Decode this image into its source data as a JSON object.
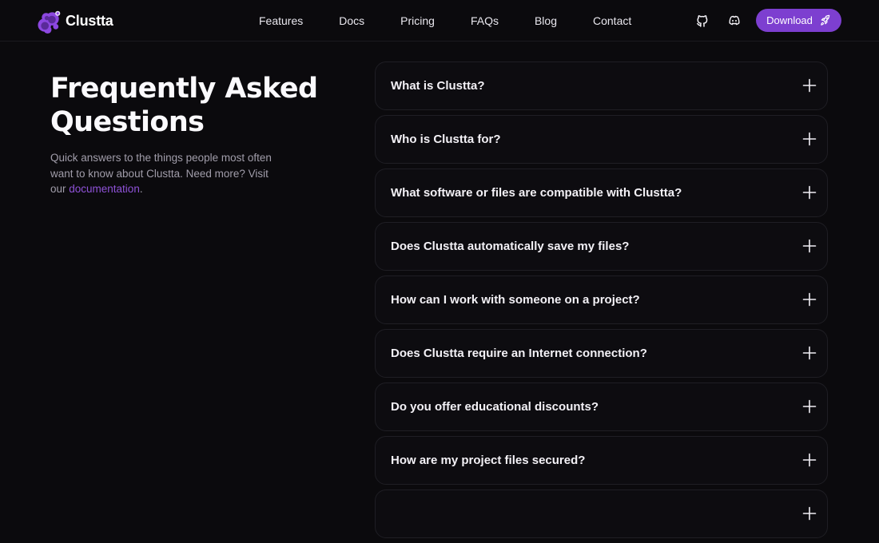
{
  "nav": {
    "brand": "Clustta",
    "links": [
      "Features",
      "Docs",
      "Pricing",
      "FAQs",
      "Blog",
      "Contact"
    ],
    "github_icon": "github-icon",
    "discord_icon": "discord-icon",
    "download_label": "Download",
    "download_icon": "rocket-icon"
  },
  "intro": {
    "title_line1": "Frequently Asked",
    "title_line2": "Questions",
    "description": "Quick answers to the things people most often want to know about Clustta. Need more? Visit our ",
    "link_text": "documentation",
    "period": "."
  },
  "faqs": [
    "What is Clustta?",
    "Who is Clustta for?",
    "What software or files are compatible with Clustta?",
    "Does Clustta automatically save my files?",
    "How can I work with someone on a project?",
    "Does Clustta require an Internet connection?",
    "Do you offer educational discounts?",
    "How are my project files secured?",
    ""
  ],
  "expand_icon": "plus-icon",
  "colors": {
    "background": "#0b0a0d",
    "accent": "#7d3fd0",
    "link": "#8f52d8",
    "card": "#0d0c10",
    "border": "#1f1e24"
  }
}
